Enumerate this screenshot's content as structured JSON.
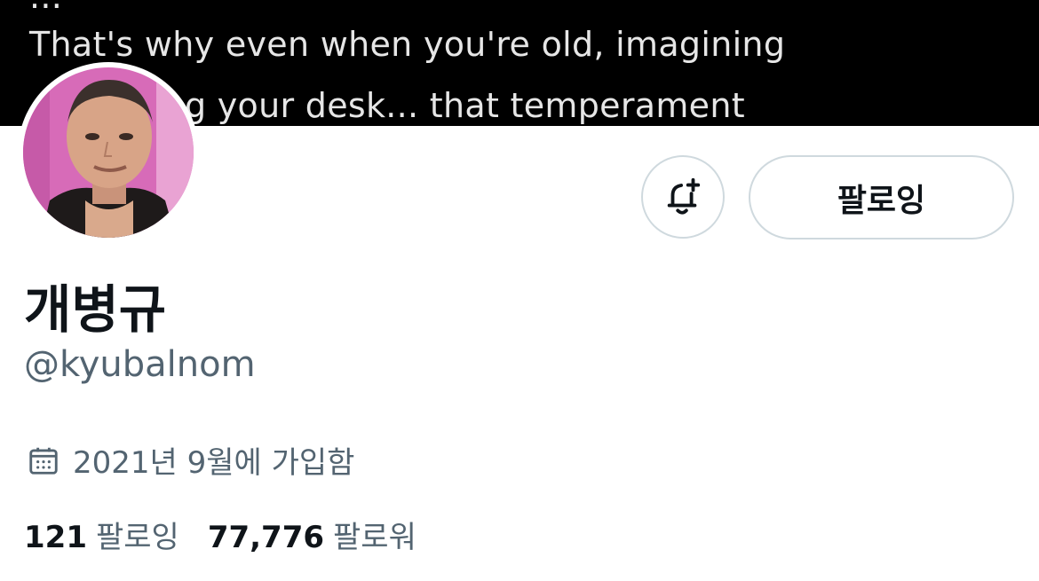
{
  "banner": {
    "lines": [
      "...",
      "That's why even when you're old, imagining",
      "... blowing your desk... that temperament"
    ]
  },
  "profile": {
    "display_name": "개병규",
    "handle": "@kyubalnom",
    "joined": "2021년 9월에 가입함",
    "joined_icon": "calendar-icon"
  },
  "actions": {
    "notify_icon": "bell-plus-icon",
    "follow_label": "팔로잉"
  },
  "stats": {
    "following_count": "121",
    "following_label": "팔로잉",
    "followers_count": "77,776",
    "followers_label": "팔로워"
  },
  "colors": {
    "text_primary": "#0f1419",
    "text_secondary": "#536471",
    "border": "#cfd9de",
    "banner_bg": "#000000"
  }
}
